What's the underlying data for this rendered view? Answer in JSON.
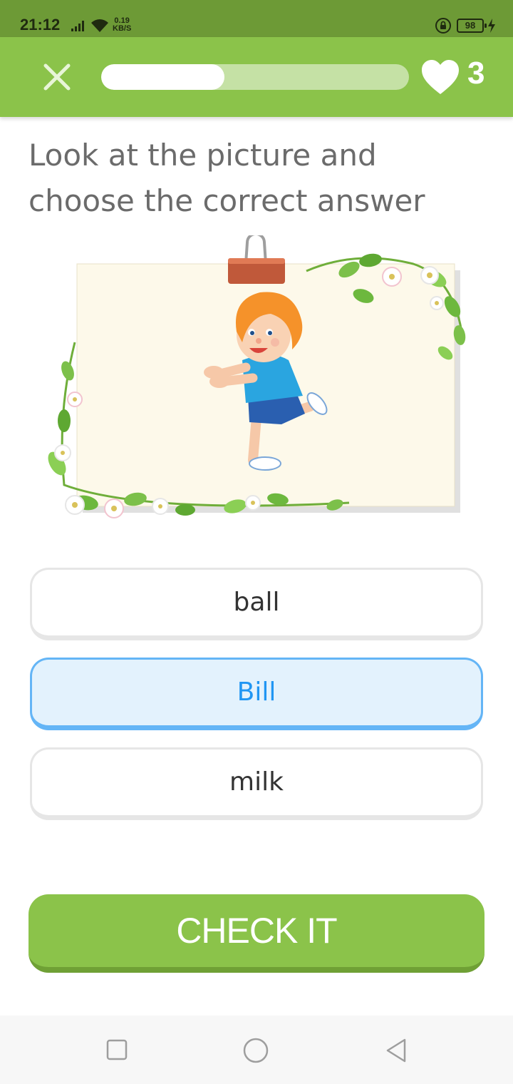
{
  "status_bar": {
    "time": "21:12",
    "net_speed_value": "0.19",
    "net_speed_unit": "KB/S",
    "battery": "98"
  },
  "header": {
    "progress_percent": 40,
    "lives": "3"
  },
  "question": {
    "text": "Look at the picture and choose the correct answer"
  },
  "options": [
    {
      "label": "ball",
      "selected": false
    },
    {
      "label": "Bill",
      "selected": true
    },
    {
      "label": "milk",
      "selected": false
    }
  ],
  "check_button": {
    "label": "CHECK IT"
  },
  "colors": {
    "brand_green": "#8bc34a",
    "status_green": "#6d9a36",
    "selected_blue": "#2196f3",
    "selected_bg": "#e3f2fd"
  }
}
